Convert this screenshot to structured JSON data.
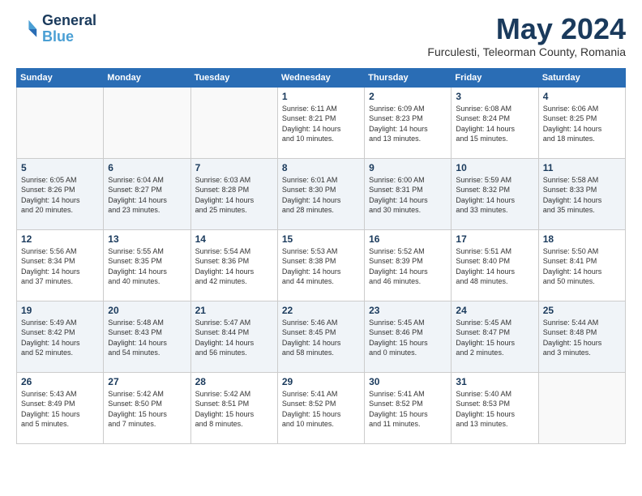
{
  "header": {
    "logo_line1": "General",
    "logo_line2": "Blue",
    "month_title": "May 2024",
    "subtitle": "Furculesti, Teleorman County, Romania"
  },
  "days_of_week": [
    "Sunday",
    "Monday",
    "Tuesday",
    "Wednesday",
    "Thursday",
    "Friday",
    "Saturday"
  ],
  "weeks": [
    [
      {
        "day": "",
        "info": ""
      },
      {
        "day": "",
        "info": ""
      },
      {
        "day": "",
        "info": ""
      },
      {
        "day": "1",
        "info": "Sunrise: 6:11 AM\nSunset: 8:21 PM\nDaylight: 14 hours\nand 10 minutes."
      },
      {
        "day": "2",
        "info": "Sunrise: 6:09 AM\nSunset: 8:23 PM\nDaylight: 14 hours\nand 13 minutes."
      },
      {
        "day": "3",
        "info": "Sunrise: 6:08 AM\nSunset: 8:24 PM\nDaylight: 14 hours\nand 15 minutes."
      },
      {
        "day": "4",
        "info": "Sunrise: 6:06 AM\nSunset: 8:25 PM\nDaylight: 14 hours\nand 18 minutes."
      }
    ],
    [
      {
        "day": "5",
        "info": "Sunrise: 6:05 AM\nSunset: 8:26 PM\nDaylight: 14 hours\nand 20 minutes."
      },
      {
        "day": "6",
        "info": "Sunrise: 6:04 AM\nSunset: 8:27 PM\nDaylight: 14 hours\nand 23 minutes."
      },
      {
        "day": "7",
        "info": "Sunrise: 6:03 AM\nSunset: 8:28 PM\nDaylight: 14 hours\nand 25 minutes."
      },
      {
        "day": "8",
        "info": "Sunrise: 6:01 AM\nSunset: 8:30 PM\nDaylight: 14 hours\nand 28 minutes."
      },
      {
        "day": "9",
        "info": "Sunrise: 6:00 AM\nSunset: 8:31 PM\nDaylight: 14 hours\nand 30 minutes."
      },
      {
        "day": "10",
        "info": "Sunrise: 5:59 AM\nSunset: 8:32 PM\nDaylight: 14 hours\nand 33 minutes."
      },
      {
        "day": "11",
        "info": "Sunrise: 5:58 AM\nSunset: 8:33 PM\nDaylight: 14 hours\nand 35 minutes."
      }
    ],
    [
      {
        "day": "12",
        "info": "Sunrise: 5:56 AM\nSunset: 8:34 PM\nDaylight: 14 hours\nand 37 minutes."
      },
      {
        "day": "13",
        "info": "Sunrise: 5:55 AM\nSunset: 8:35 PM\nDaylight: 14 hours\nand 40 minutes."
      },
      {
        "day": "14",
        "info": "Sunrise: 5:54 AM\nSunset: 8:36 PM\nDaylight: 14 hours\nand 42 minutes."
      },
      {
        "day": "15",
        "info": "Sunrise: 5:53 AM\nSunset: 8:38 PM\nDaylight: 14 hours\nand 44 minutes."
      },
      {
        "day": "16",
        "info": "Sunrise: 5:52 AM\nSunset: 8:39 PM\nDaylight: 14 hours\nand 46 minutes."
      },
      {
        "day": "17",
        "info": "Sunrise: 5:51 AM\nSunset: 8:40 PM\nDaylight: 14 hours\nand 48 minutes."
      },
      {
        "day": "18",
        "info": "Sunrise: 5:50 AM\nSunset: 8:41 PM\nDaylight: 14 hours\nand 50 minutes."
      }
    ],
    [
      {
        "day": "19",
        "info": "Sunrise: 5:49 AM\nSunset: 8:42 PM\nDaylight: 14 hours\nand 52 minutes."
      },
      {
        "day": "20",
        "info": "Sunrise: 5:48 AM\nSunset: 8:43 PM\nDaylight: 14 hours\nand 54 minutes."
      },
      {
        "day": "21",
        "info": "Sunrise: 5:47 AM\nSunset: 8:44 PM\nDaylight: 14 hours\nand 56 minutes."
      },
      {
        "day": "22",
        "info": "Sunrise: 5:46 AM\nSunset: 8:45 PM\nDaylight: 14 hours\nand 58 minutes."
      },
      {
        "day": "23",
        "info": "Sunrise: 5:45 AM\nSunset: 8:46 PM\nDaylight: 15 hours\nand 0 minutes."
      },
      {
        "day": "24",
        "info": "Sunrise: 5:45 AM\nSunset: 8:47 PM\nDaylight: 15 hours\nand 2 minutes."
      },
      {
        "day": "25",
        "info": "Sunrise: 5:44 AM\nSunset: 8:48 PM\nDaylight: 15 hours\nand 3 minutes."
      }
    ],
    [
      {
        "day": "26",
        "info": "Sunrise: 5:43 AM\nSunset: 8:49 PM\nDaylight: 15 hours\nand 5 minutes."
      },
      {
        "day": "27",
        "info": "Sunrise: 5:42 AM\nSunset: 8:50 PM\nDaylight: 15 hours\nand 7 minutes."
      },
      {
        "day": "28",
        "info": "Sunrise: 5:42 AM\nSunset: 8:51 PM\nDaylight: 15 hours\nand 8 minutes."
      },
      {
        "day": "29",
        "info": "Sunrise: 5:41 AM\nSunset: 8:52 PM\nDaylight: 15 hours\nand 10 minutes."
      },
      {
        "day": "30",
        "info": "Sunrise: 5:41 AM\nSunset: 8:52 PM\nDaylight: 15 hours\nand 11 minutes."
      },
      {
        "day": "31",
        "info": "Sunrise: 5:40 AM\nSunset: 8:53 PM\nDaylight: 15 hours\nand 13 minutes."
      },
      {
        "day": "",
        "info": ""
      }
    ]
  ]
}
